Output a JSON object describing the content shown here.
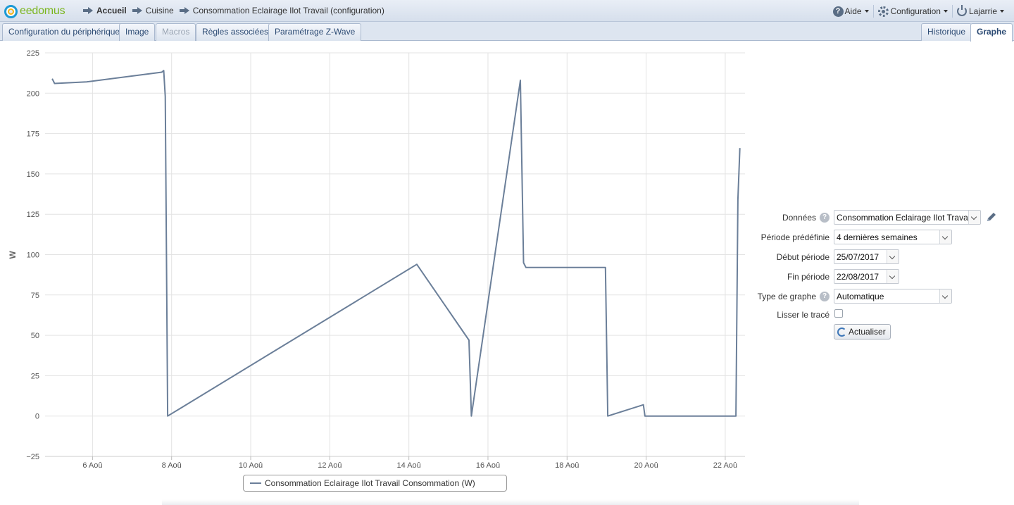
{
  "app": {
    "logo_text": "eedomus"
  },
  "breadcrumb": {
    "items": [
      "Accueil",
      "Cuisine",
      "Consommation Eclairage Ilot Travail (configuration)"
    ]
  },
  "topmenu": {
    "help": "Aide",
    "config": "Configuration",
    "user": "Lajarrie"
  },
  "tabs": {
    "left": [
      "Configuration du périphérique",
      "Image",
      "Macros",
      "Règles associées",
      "Paramétrage Z-Wave"
    ],
    "right": [
      "Historique",
      "Graphe"
    ],
    "disabled": "Macros",
    "active": "Graphe"
  },
  "form": {
    "donnees_label": "Données",
    "donnees_value": "Consommation Eclairage Ilot Travail (W)",
    "periode_label": "Période prédéfinie",
    "periode_value": "4 dernières semaines",
    "debut_label": "Début période",
    "debut_value": "25/07/2017",
    "fin_label": "Fin période",
    "fin_value": "22/08/2017",
    "type_label": "Type de graphe",
    "type_value": "Automatique",
    "lisser_label": "Lisser le tracé",
    "actualiser_label": "Actualiser"
  },
  "colors": {
    "series": "#6b7f99",
    "grid": "#e3e3e3",
    "accent": "#2b4a73"
  },
  "chart_data": {
    "type": "line",
    "ylabel": "W",
    "ylim": [
      -25,
      225
    ],
    "yticks": [
      -25,
      0,
      25,
      50,
      75,
      100,
      125,
      150,
      175,
      200,
      225
    ],
    "xlim": [
      4.8,
      22.5
    ],
    "xticks": [
      6,
      8,
      10,
      12,
      14,
      16,
      18,
      20,
      22
    ],
    "xtick_labels": [
      "6 Aoû",
      "8 Aoû",
      "10 Aoû",
      "12 Aoû",
      "14 Aoû",
      "16 Aoû",
      "18 Aoû",
      "20 Aoû",
      "22 Aoû"
    ],
    "series": [
      {
        "name": "Consommation Eclairage Ilot Travail Consommation (W)",
        "x": [
          4.98,
          5.04,
          5.85,
          7.75,
          7.8,
          7.84,
          7.9,
          14.2,
          15.52,
          15.58,
          16.82,
          16.9,
          16.96,
          18.97,
          19.03,
          19.93,
          19.97,
          22.27,
          22.32,
          22.37
        ],
        "y": [
          209,
          206,
          207,
          213,
          214,
          198,
          0,
          94,
          47,
          0,
          208,
          95,
          92,
          92,
          0,
          7,
          0,
          0,
          134,
          166
        ]
      }
    ]
  }
}
